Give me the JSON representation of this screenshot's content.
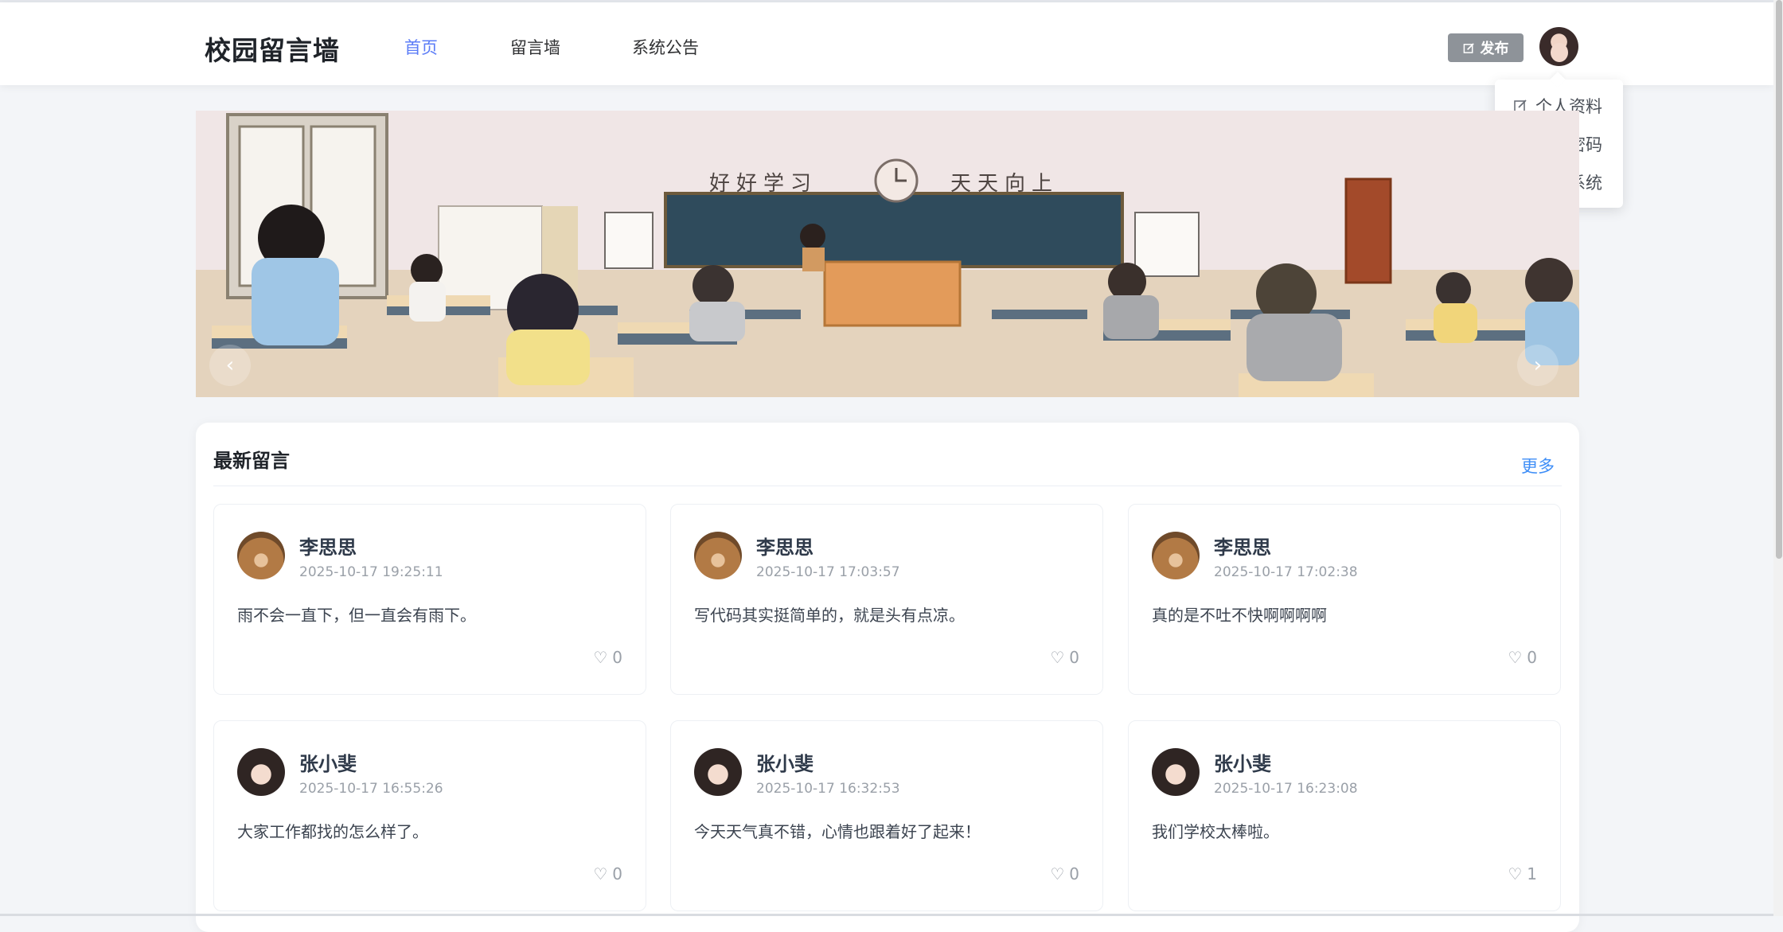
{
  "header": {
    "brand": "校园留言墙",
    "nav": [
      "首页",
      "留言墙",
      "系统公告"
    ],
    "active_nav": "首页",
    "publish_label": "发布"
  },
  "user_menu": {
    "items": [
      {
        "label": "个人资料",
        "icon": "edit-icon"
      },
      {
        "label": "修改密码",
        "icon": "lock-icon"
      },
      {
        "label": "退出系统",
        "icon": "power-icon"
      }
    ]
  },
  "banner": {
    "slogan_left": "好好学习",
    "slogan_right": "天天向上",
    "prev_icon": "chevron-left-icon",
    "next_icon": "chevron-right-icon"
  },
  "latest": {
    "title": "最新留言",
    "more": "更多",
    "cards": [
      {
        "name": "李思思",
        "time": "2025-10-17 19:25:11",
        "content": "雨不会一直下，但一直会有雨下。",
        "likes": "0",
        "avatar": "bear"
      },
      {
        "name": "李思思",
        "time": "2025-10-17 17:03:57",
        "content": "写代码其实挺简单的，就是头有点凉。",
        "likes": "0",
        "avatar": "bear"
      },
      {
        "name": "李思思",
        "time": "2025-10-17 17:02:38",
        "content": "真的是不吐不快啊啊啊啊",
        "likes": "0",
        "avatar": "bear"
      },
      {
        "name": "张小斐",
        "time": "2025-10-17 16:55:26",
        "content": "大家工作都找的怎么样了。",
        "likes": "0",
        "avatar": "girl"
      },
      {
        "name": "张小斐",
        "time": "2025-10-17 16:32:53",
        "content": "今天天气真不错，心情也跟着好了起来！",
        "likes": "0",
        "avatar": "girl"
      },
      {
        "name": "张小斐",
        "time": "2025-10-17 16:23:08",
        "content": "我们学校太棒啦。",
        "likes": "1",
        "avatar": "girl"
      }
    ]
  },
  "colors": {
    "accent": "#5b7cf7",
    "link": "#3e8ef7",
    "publish_bg": "#8e9399",
    "page_bg": "#f3f5f8"
  }
}
